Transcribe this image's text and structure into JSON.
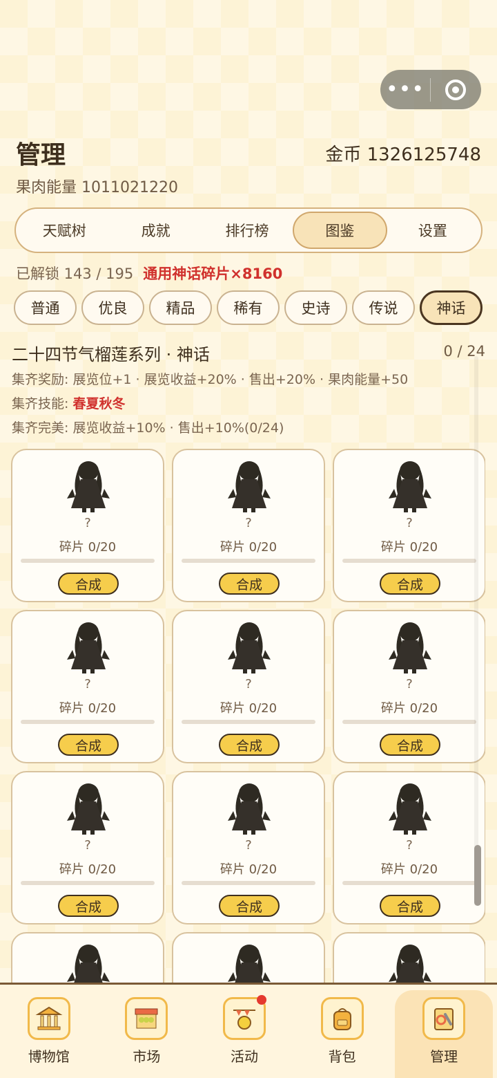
{
  "page": {
    "title": "管理",
    "gold": "金币 1326125748",
    "energy": "果肉能量 1011021220"
  },
  "main_tabs": [
    {
      "label": "天赋树",
      "active": false
    },
    {
      "label": "成就",
      "active": false
    },
    {
      "label": "排行榜",
      "active": false
    },
    {
      "label": "图鉴",
      "active": true
    },
    {
      "label": "设置",
      "active": false
    }
  ],
  "unlock": {
    "text": "已解锁 143 / 195",
    "shards": "通用神话碎片×8160"
  },
  "rarity_tabs": [
    {
      "label": "普通",
      "active": false
    },
    {
      "label": "优良",
      "active": false
    },
    {
      "label": "精品",
      "active": false
    },
    {
      "label": "稀有",
      "active": false
    },
    {
      "label": "史诗",
      "active": false
    },
    {
      "label": "传说",
      "active": false
    },
    {
      "label": "神话",
      "active": true
    }
  ],
  "series": {
    "title": "二十四节气榴莲系列 · 神话",
    "count": "0 / 24",
    "reward_label": "集齐奖励:",
    "reward": "展览位+1 · 展览收益+20% · 售出+20% · 果肉能量+50",
    "skill_label": "集齐技能:",
    "skill": "春夏秋冬",
    "perfect_label": "集齐完美:",
    "perfect": "展览收益+10% · 售出+10%(0/24)"
  },
  "cards": [
    {
      "name": "?",
      "fragments": "碎片 0/20",
      "progress": 0,
      "button": "合成"
    },
    {
      "name": "?",
      "fragments": "碎片 0/20",
      "progress": 0,
      "button": "合成"
    },
    {
      "name": "?",
      "fragments": "碎片 0/20",
      "progress": 0,
      "button": "合成"
    },
    {
      "name": "?",
      "fragments": "碎片 0/20",
      "progress": 0,
      "button": "合成"
    },
    {
      "name": "?",
      "fragments": "碎片 0/20",
      "progress": 0,
      "button": "合成"
    },
    {
      "name": "?",
      "fragments": "碎片 0/20",
      "progress": 0,
      "button": "合成"
    },
    {
      "name": "?",
      "fragments": "碎片 0/20",
      "progress": 0,
      "button": "合成"
    },
    {
      "name": "?",
      "fragments": "碎片 0/20",
      "progress": 0,
      "button": "合成"
    },
    {
      "name": "?",
      "fragments": "碎片 0/20",
      "progress": 0,
      "button": "合成"
    },
    {
      "name": "",
      "fragments": "",
      "progress": 0,
      "button": ""
    },
    {
      "name": "",
      "fragments": "",
      "progress": 0,
      "button": ""
    },
    {
      "name": "",
      "fragments": "",
      "progress": 0,
      "button": ""
    }
  ],
  "bottom_nav": [
    {
      "label": "博物馆",
      "icon": "museum-icon",
      "active": false,
      "badge": false
    },
    {
      "label": "市场",
      "icon": "market-icon",
      "active": false,
      "badge": false
    },
    {
      "label": "活动",
      "icon": "activity-icon",
      "active": false,
      "badge": true
    },
    {
      "label": "背包",
      "icon": "backpack-icon",
      "active": false,
      "badge": false
    },
    {
      "label": "管理",
      "icon": "manage-icon",
      "active": true,
      "badge": false
    }
  ],
  "colors": {
    "accent_red": "#d0312d",
    "button_yellow": "#f6cd4c",
    "active_tab": "#f8e3b8"
  }
}
